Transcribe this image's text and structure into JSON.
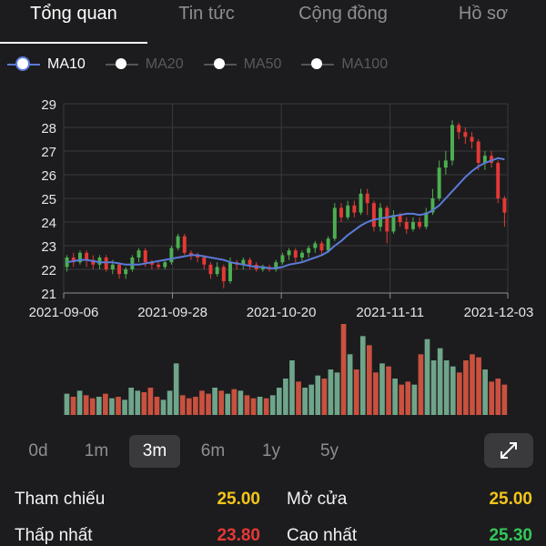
{
  "tabs": [
    "Tổng quan",
    "Tin tức",
    "Cộng đồng",
    "Hồ sơ"
  ],
  "legend": [
    {
      "label": "MA10",
      "active": true
    },
    {
      "label": "MA20",
      "active": false
    },
    {
      "label": "MA50",
      "active": false
    },
    {
      "label": "MA100",
      "active": false
    }
  ],
  "colors": {
    "up": "#4caf50",
    "down": "#e53935",
    "ma": "#5a7bd8",
    "vol_up": "#6fa58a",
    "vol_down": "#c9513f"
  },
  "chart_data": {
    "type": "candlestick",
    "ylim": [
      21,
      29
    ],
    "y_ticks": [
      "21",
      "22",
      "23",
      "24",
      "25",
      "26",
      "27",
      "28",
      "29"
    ],
    "x_ticks": [
      "2021-09-06",
      "2021-09-28",
      "2021-10-20",
      "2021-11-11",
      "2021-12-03"
    ],
    "grid": true,
    "candles": [
      {
        "o": 22.1,
        "c": 22.5,
        "h": 22.6,
        "l": 21.9
      },
      {
        "o": 22.5,
        "c": 22.3,
        "h": 22.7,
        "l": 22.1
      },
      {
        "o": 22.3,
        "c": 22.7,
        "h": 22.8,
        "l": 22.2
      },
      {
        "o": 22.7,
        "c": 22.4,
        "h": 22.8,
        "l": 22.1
      },
      {
        "o": 22.4,
        "c": 22.2,
        "h": 22.6,
        "l": 22.0
      },
      {
        "o": 22.2,
        "c": 22.5,
        "h": 22.6,
        "l": 22.0
      },
      {
        "o": 22.5,
        "c": 22.0,
        "h": 22.6,
        "l": 21.9
      },
      {
        "o": 22.0,
        "c": 22.2,
        "h": 22.4,
        "l": 21.8
      },
      {
        "o": 22.2,
        "c": 21.8,
        "h": 22.3,
        "l": 21.6
      },
      {
        "o": 21.8,
        "c": 22.0,
        "h": 22.1,
        "l": 21.6
      },
      {
        "o": 22.0,
        "c": 22.5,
        "h": 22.6,
        "l": 21.9
      },
      {
        "o": 22.5,
        "c": 22.8,
        "h": 22.9,
        "l": 22.3
      },
      {
        "o": 22.8,
        "c": 22.3,
        "h": 22.9,
        "l": 22.1
      },
      {
        "o": 22.3,
        "c": 22.2,
        "h": 22.4,
        "l": 22.0
      },
      {
        "o": 22.2,
        "c": 22.1,
        "h": 22.3,
        "l": 22.0
      },
      {
        "o": 22.1,
        "c": 22.3,
        "h": 22.4,
        "l": 22.0
      },
      {
        "o": 22.3,
        "c": 22.9,
        "h": 23.0,
        "l": 22.2
      },
      {
        "o": 22.9,
        "c": 23.4,
        "h": 23.5,
        "l": 22.8
      },
      {
        "o": 23.4,
        "c": 22.7,
        "h": 23.5,
        "l": 22.6
      },
      {
        "o": 22.7,
        "c": 22.6,
        "h": 22.8,
        "l": 22.4
      },
      {
        "o": 22.6,
        "c": 22.5,
        "h": 22.7,
        "l": 22.3
      },
      {
        "o": 22.5,
        "c": 22.2,
        "h": 22.6,
        "l": 22.0
      },
      {
        "o": 22.2,
        "c": 21.8,
        "h": 22.3,
        "l": 21.6
      },
      {
        "o": 21.8,
        "c": 22.1,
        "h": 22.3,
        "l": 21.7
      },
      {
        "o": 22.1,
        "c": 21.5,
        "h": 22.2,
        "l": 21.2
      },
      {
        "o": 21.5,
        "c": 22.3,
        "h": 22.5,
        "l": 21.4
      },
      {
        "o": 22.3,
        "c": 22.2,
        "h": 22.4,
        "l": 22.0
      },
      {
        "o": 22.2,
        "c": 22.4,
        "h": 22.5,
        "l": 22.0
      },
      {
        "o": 22.4,
        "c": 22.2,
        "h": 22.5,
        "l": 22.0
      },
      {
        "o": 22.2,
        "c": 22.0,
        "h": 22.3,
        "l": 21.9
      },
      {
        "o": 22.0,
        "c": 22.1,
        "h": 22.2,
        "l": 21.9
      },
      {
        "o": 22.1,
        "c": 22.0,
        "h": 22.2,
        "l": 21.9
      },
      {
        "o": 22.0,
        "c": 22.3,
        "h": 22.4,
        "l": 21.9
      },
      {
        "o": 22.3,
        "c": 22.6,
        "h": 22.7,
        "l": 22.2
      },
      {
        "o": 22.6,
        "c": 22.8,
        "h": 22.9,
        "l": 22.4
      },
      {
        "o": 22.8,
        "c": 22.5,
        "h": 22.9,
        "l": 22.3
      },
      {
        "o": 22.5,
        "c": 22.7,
        "h": 22.8,
        "l": 22.3
      },
      {
        "o": 22.7,
        "c": 22.9,
        "h": 23.0,
        "l": 22.5
      },
      {
        "o": 22.9,
        "c": 23.1,
        "h": 23.2,
        "l": 22.7
      },
      {
        "o": 23.1,
        "c": 22.8,
        "h": 23.2,
        "l": 22.6
      },
      {
        "o": 22.8,
        "c": 23.3,
        "h": 23.4,
        "l": 22.7
      },
      {
        "o": 23.3,
        "c": 24.6,
        "h": 24.8,
        "l": 23.2
      },
      {
        "o": 24.6,
        "c": 24.2,
        "h": 24.8,
        "l": 24.0
      },
      {
        "o": 24.2,
        "c": 24.7,
        "h": 24.9,
        "l": 24.1
      },
      {
        "o": 24.7,
        "c": 24.4,
        "h": 24.9,
        "l": 24.2
      },
      {
        "o": 24.4,
        "c": 25.2,
        "h": 25.4,
        "l": 24.3
      },
      {
        "o": 25.2,
        "c": 24.8,
        "h": 25.4,
        "l": 24.3
      },
      {
        "o": 24.8,
        "c": 23.8,
        "h": 24.9,
        "l": 23.6
      },
      {
        "o": 23.8,
        "c": 24.6,
        "h": 24.8,
        "l": 23.6
      },
      {
        "o": 24.6,
        "c": 23.6,
        "h": 24.7,
        "l": 23.1
      },
      {
        "o": 23.6,
        "c": 24.3,
        "h": 24.5,
        "l": 23.5
      },
      {
        "o": 24.3,
        "c": 24.0,
        "h": 24.4,
        "l": 23.8
      },
      {
        "o": 24.0,
        "c": 23.7,
        "h": 24.2,
        "l": 23.5
      },
      {
        "o": 23.7,
        "c": 24.0,
        "h": 24.2,
        "l": 23.6
      },
      {
        "o": 24.0,
        "c": 23.8,
        "h": 24.2,
        "l": 23.7
      },
      {
        "o": 23.8,
        "c": 24.4,
        "h": 24.6,
        "l": 23.7
      },
      {
        "o": 24.4,
        "c": 25.0,
        "h": 25.4,
        "l": 24.3
      },
      {
        "o": 25.0,
        "c": 26.3,
        "h": 26.6,
        "l": 24.9
      },
      {
        "o": 26.3,
        "c": 26.6,
        "h": 27.0,
        "l": 26.0
      },
      {
        "o": 26.6,
        "c": 28.1,
        "h": 28.3,
        "l": 26.4
      },
      {
        "o": 28.1,
        "c": 27.8,
        "h": 28.2,
        "l": 27.5
      },
      {
        "o": 27.8,
        "c": 27.6,
        "h": 28.0,
        "l": 27.3
      },
      {
        "o": 27.6,
        "c": 27.4,
        "h": 27.8,
        "l": 27.1
      },
      {
        "o": 27.4,
        "c": 26.5,
        "h": 27.5,
        "l": 26.2
      },
      {
        "o": 26.5,
        "c": 26.8,
        "h": 27.0,
        "l": 26.2
      },
      {
        "o": 26.8,
        "c": 26.5,
        "h": 27.0,
        "l": 26.3
      },
      {
        "o": 26.5,
        "c": 25.0,
        "h": 26.6,
        "l": 24.8
      },
      {
        "o": 25.0,
        "c": 24.4,
        "h": 25.1,
        "l": 23.8
      }
    ],
    "ma10": [
      22.3,
      22.35,
      22.4,
      22.4,
      22.35,
      22.3,
      22.3,
      22.3,
      22.25,
      22.2,
      22.2,
      22.2,
      22.25,
      22.3,
      22.35,
      22.4,
      22.45,
      22.5,
      22.55,
      22.6,
      22.6,
      22.55,
      22.5,
      22.45,
      22.4,
      22.3,
      22.25,
      22.2,
      22.15,
      22.1,
      22.1,
      22.05,
      22.05,
      22.1,
      22.2,
      22.25,
      22.3,
      22.4,
      22.5,
      22.6,
      22.75,
      23.0,
      23.2,
      23.45,
      23.65,
      23.85,
      24.0,
      24.1,
      24.15,
      24.2,
      24.25,
      24.3,
      24.35,
      24.35,
      24.3,
      24.35,
      24.5,
      24.7,
      25.0,
      25.3,
      25.6,
      25.9,
      26.15,
      26.35,
      26.5,
      26.6,
      26.7,
      26.65
    ],
    "volume": [
      14,
      12,
      16,
      13,
      11,
      12,
      14,
      11,
      12,
      10,
      18,
      16,
      15,
      18,
      12,
      10,
      16,
      34,
      13,
      11,
      12,
      16,
      14,
      18,
      16,
      14,
      17,
      16,
      13,
      11,
      12,
      11,
      13,
      18,
      24,
      36,
      22,
      18,
      20,
      26,
      24,
      30,
      28,
      60,
      40,
      30,
      52,
      46,
      28,
      34,
      32,
      24,
      20,
      22,
      20,
      40,
      50,
      36,
      44,
      36,
      32,
      28,
      36,
      40,
      38,
      30,
      22,
      24,
      20
    ]
  },
  "ranges": [
    "0d",
    "1m",
    "3m",
    "6m",
    "1y",
    "5y"
  ],
  "active_range": "3m",
  "stats": {
    "ref_label": "Tham chiếu",
    "ref_value": "25.00",
    "open_label": "Mở cửa",
    "open_value": "25.00",
    "low_label": "Thấp nhất",
    "low_value": "23.80",
    "high_label": "Cao nhất",
    "high_value": "25.30"
  }
}
